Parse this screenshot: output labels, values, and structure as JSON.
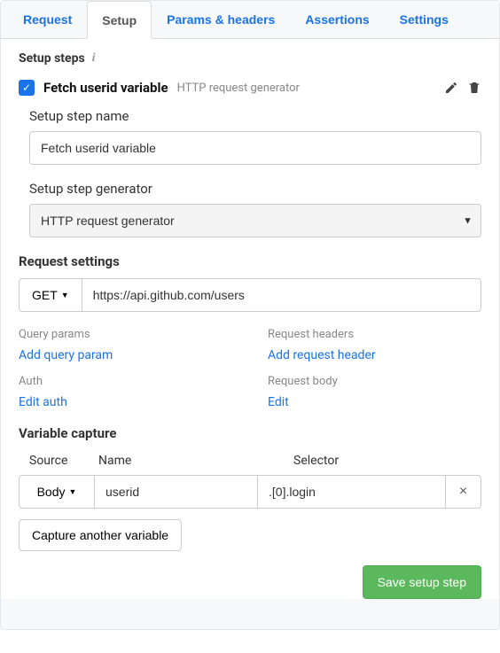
{
  "tabs": {
    "request": "Request",
    "setup": "Setup",
    "params": "Params & headers",
    "assertions": "Assertions",
    "settings": "Settings"
  },
  "section": {
    "title": "Setup steps"
  },
  "step": {
    "title": "Fetch userid variable",
    "subtitle": "HTTP request generator"
  },
  "fields": {
    "name_label": "Setup step name",
    "name_value": "Fetch userid variable",
    "gen_label": "Setup step generator",
    "gen_value": "HTTP request generator"
  },
  "request": {
    "title": "Request settings",
    "method": "GET",
    "url": "https://api.github.com/users"
  },
  "sections": {
    "query_params": "Query params",
    "add_query": "Add query param",
    "req_headers": "Request headers",
    "add_header": "Add request header",
    "auth": "Auth",
    "edit_auth": "Edit auth",
    "req_body": "Request body",
    "edit_body": "Edit"
  },
  "capture": {
    "title": "Variable capture",
    "cols": {
      "source": "Source",
      "name": "Name",
      "selector": "Selector"
    },
    "row": {
      "source": "Body",
      "name": "userid",
      "selector": ".[0].login",
      "remove": "×"
    },
    "another": "Capture another variable"
  },
  "save_label": "Save setup step"
}
